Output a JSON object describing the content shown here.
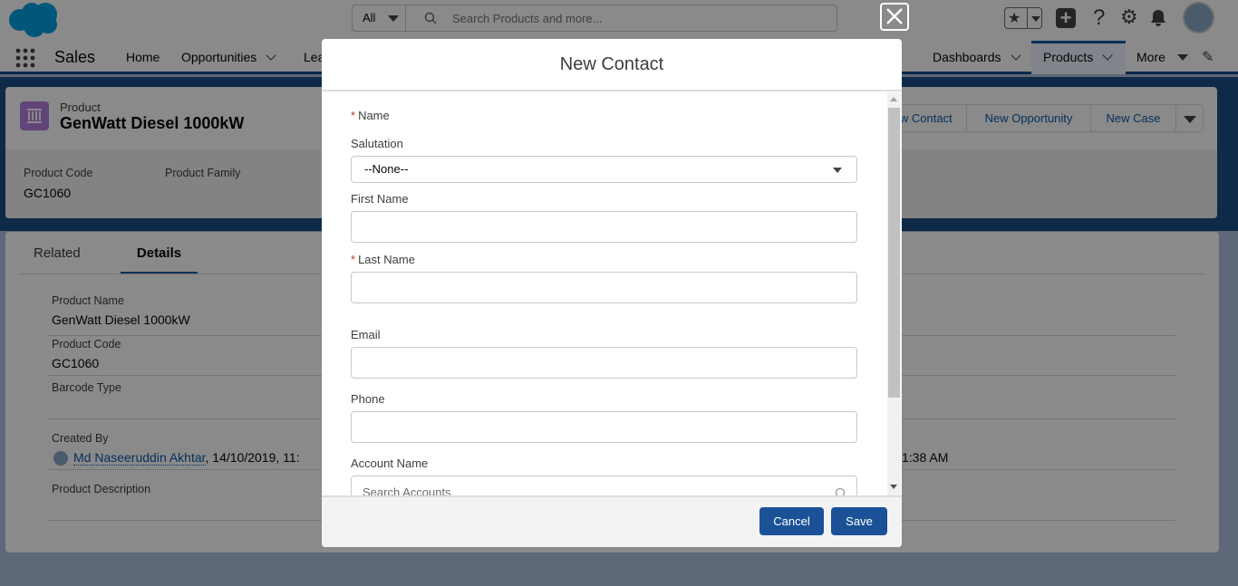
{
  "header": {
    "search_scope": "All",
    "search_placeholder": "Search Products and more..."
  },
  "nav": {
    "app_name": "Sales",
    "items": [
      {
        "label": "Home"
      },
      {
        "label": "Opportunities"
      },
      {
        "label": "Lea"
      },
      {
        "label": "Dashboards"
      },
      {
        "label": "Products"
      },
      {
        "label": "More"
      }
    ]
  },
  "record": {
    "type_label": "Product",
    "title": "GenWatt Diesel 1000kW",
    "actions": [
      "New Contact",
      "New Opportunity",
      "New Case"
    ],
    "highlights": [
      {
        "label": "Product Code",
        "value": "GC1060"
      },
      {
        "label": "Product Family",
        "value": ""
      }
    ]
  },
  "tabs": [
    {
      "label": "Related"
    },
    {
      "label": "Details"
    }
  ],
  "details": {
    "fields": [
      {
        "label": "Product Name",
        "value": "GenWatt Diesel 1000kW"
      },
      {
        "label": "Product Code",
        "value": "GC1060"
      },
      {
        "label": "Barcode Type",
        "value": ""
      },
      {
        "label": "Created By",
        "user": "Md Naseeruddin Akhtar",
        "date": ", 14/10/2019, 11:"
      },
      {
        "label": "Product Description",
        "value": ""
      }
    ],
    "modified_time": "1:38 AM"
  },
  "modal": {
    "title": "New Contact",
    "name_label": "Name",
    "salutation_label": "Salutation",
    "salutation_value": "--None--",
    "first_name_label": "First Name",
    "last_name_label": "Last Name",
    "email_label": "Email",
    "phone_label": "Phone",
    "account_label": "Account Name",
    "account_placeholder": "Search Accounts",
    "cancel": "Cancel",
    "save": "Save"
  }
}
